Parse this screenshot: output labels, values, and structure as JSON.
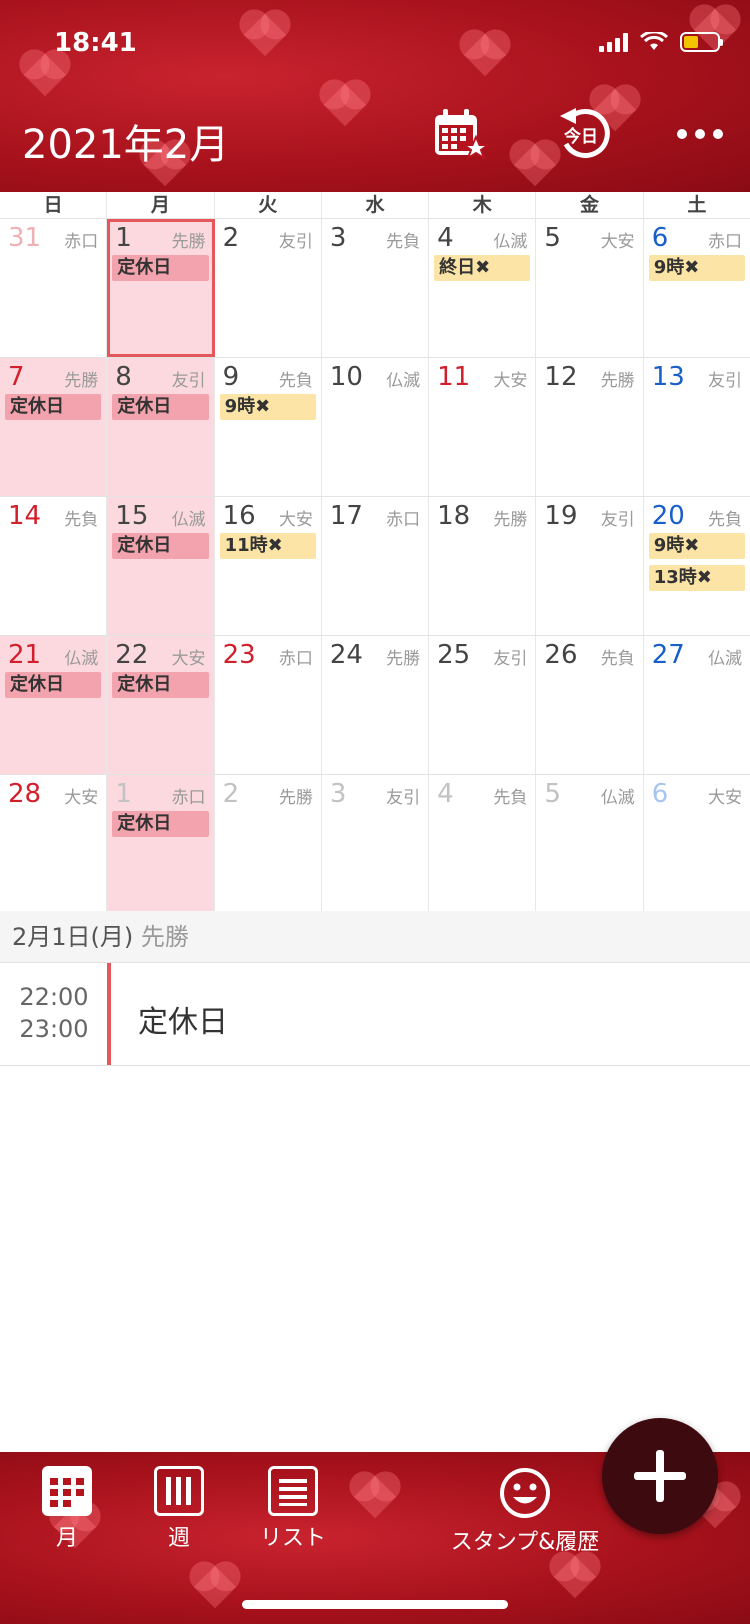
{
  "status": {
    "time": "18:41"
  },
  "header": {
    "title": "2021年2月",
    "today_label": "今日"
  },
  "weekdays": [
    "日",
    "月",
    "火",
    "水",
    "木",
    "金",
    "土"
  ],
  "weeks": [
    [
      {
        "day": "31",
        "rokuyo": "赤口"
      },
      {
        "day": "1",
        "rokuyo": "先勝",
        "events": [
          "定休日"
        ]
      },
      {
        "day": "2",
        "rokuyo": "友引"
      },
      {
        "day": "3",
        "rokuyo": "先負"
      },
      {
        "day": "4",
        "rokuyo": "仏滅",
        "events": [
          "終日✖"
        ]
      },
      {
        "day": "5",
        "rokuyo": "大安"
      },
      {
        "day": "6",
        "rokuyo": "赤口",
        "events": [
          "9時✖"
        ]
      }
    ],
    [
      {
        "day": "7",
        "rokuyo": "先勝",
        "events": [
          "定休日"
        ]
      },
      {
        "day": "8",
        "rokuyo": "友引",
        "events": [
          "定休日"
        ]
      },
      {
        "day": "9",
        "rokuyo": "先負",
        "events": [
          "9時✖"
        ]
      },
      {
        "day": "10",
        "rokuyo": "仏滅"
      },
      {
        "day": "11",
        "rokuyo": "大安"
      },
      {
        "day": "12",
        "rokuyo": "先勝"
      },
      {
        "day": "13",
        "rokuyo": "友引"
      }
    ],
    [
      {
        "day": "14",
        "rokuyo": "先負"
      },
      {
        "day": "15",
        "rokuyo": "仏滅",
        "events": [
          "定休日"
        ]
      },
      {
        "day": "16",
        "rokuyo": "大安",
        "events": [
          "11時✖"
        ]
      },
      {
        "day": "17",
        "rokuyo": "赤口"
      },
      {
        "day": "18",
        "rokuyo": "先勝"
      },
      {
        "day": "19",
        "rokuyo": "友引"
      },
      {
        "day": "20",
        "rokuyo": "先負",
        "events": [
          "9時✖",
          "13時✖"
        ]
      }
    ],
    [
      {
        "day": "21",
        "rokuyo": "仏滅",
        "events": [
          "定休日"
        ]
      },
      {
        "day": "22",
        "rokuyo": "大安",
        "events": [
          "定休日"
        ]
      },
      {
        "day": "23",
        "rokuyo": "赤口"
      },
      {
        "day": "24",
        "rokuyo": "先勝"
      },
      {
        "day": "25",
        "rokuyo": "友引"
      },
      {
        "day": "26",
        "rokuyo": "先負"
      },
      {
        "day": "27",
        "rokuyo": "仏滅"
      }
    ],
    [
      {
        "day": "28",
        "rokuyo": "大安"
      },
      {
        "day": "1",
        "rokuyo": "赤口",
        "events": [
          "定休日"
        ]
      },
      {
        "day": "2",
        "rokuyo": "先勝"
      },
      {
        "day": "3",
        "rokuyo": "友引"
      },
      {
        "day": "4",
        "rokuyo": "先負"
      },
      {
        "day": "5",
        "rokuyo": "仏滅"
      },
      {
        "day": "6",
        "rokuyo": "大安"
      }
    ]
  ],
  "detail": {
    "date_label": "2月1日(月)",
    "rokuyo": "先勝",
    "event": {
      "start": "22:00",
      "end": "23:00",
      "title": "定休日"
    }
  },
  "tabs": {
    "month": "月",
    "week": "週",
    "list": "リスト",
    "stamp": "スタンプ&履歴"
  },
  "colors": {
    "brand_red": "#b5141f",
    "holiday_pink": "#fbd9df",
    "event_pink": "#f3a3ad",
    "event_yellow": "#fbe4a6",
    "fab": "#3d0a10"
  }
}
